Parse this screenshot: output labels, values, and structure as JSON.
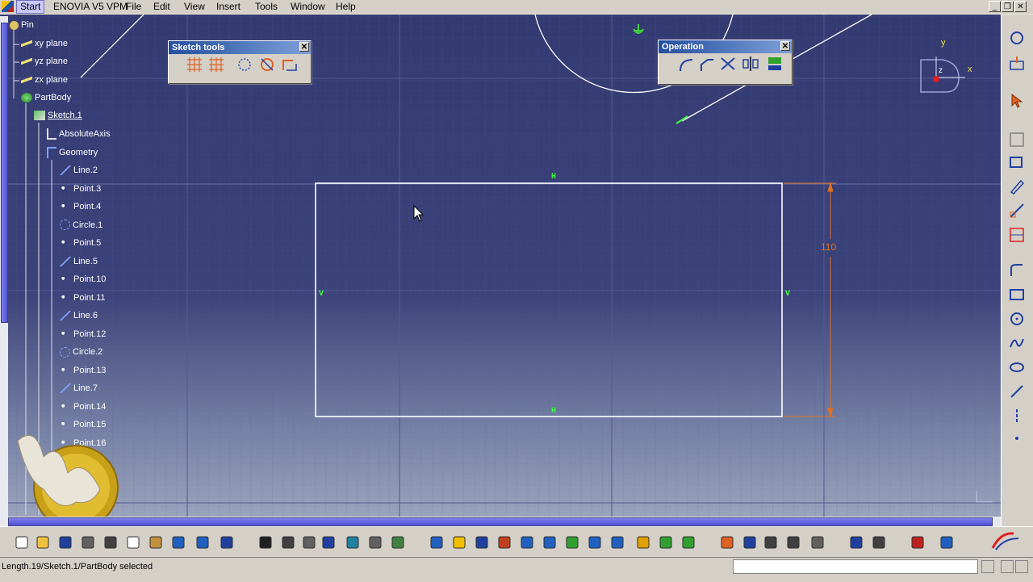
{
  "menu": {
    "items": [
      "Start",
      "ENOVIA V5 VPM",
      "File",
      "Edit",
      "View",
      "Insert",
      "Tools",
      "Window",
      "Help"
    ]
  },
  "tree": {
    "root": "Pin",
    "planes": [
      "xy plane",
      "yz plane",
      "zx plane"
    ],
    "part_body": "PartBody",
    "sketch": "Sketch.1",
    "absolute_axis": "AbsoluteAxis",
    "geometry": "Geometry",
    "geometry_items": [
      "Line.2",
      "Point.3",
      "Point.4",
      "Circle.1",
      "Point.5",
      "Line.5",
      "Point.10",
      "Point.11",
      "Line.6",
      "Point.12",
      "Circle.2",
      "Point.13",
      "Line.7",
      "Point.14",
      "Point.15",
      "Point.16"
    ]
  },
  "sketch_tools": {
    "title": "Sketch tools"
  },
  "operation": {
    "title": "Operation"
  },
  "compass": {
    "x": "x",
    "y": "y",
    "z": "z"
  },
  "dimension": {
    "value": "110"
  },
  "constraints": {
    "h_top": "H",
    "h_bottom": "H",
    "v_left": "V",
    "v_right": "V"
  },
  "status": {
    "text": "Length.19/Sketch.1/PartBody selected"
  },
  "colors": {
    "viewport_top": "#343a72",
    "geometry": "#ffffff",
    "dimension": "#e07020",
    "constraint": "#40ff40"
  }
}
